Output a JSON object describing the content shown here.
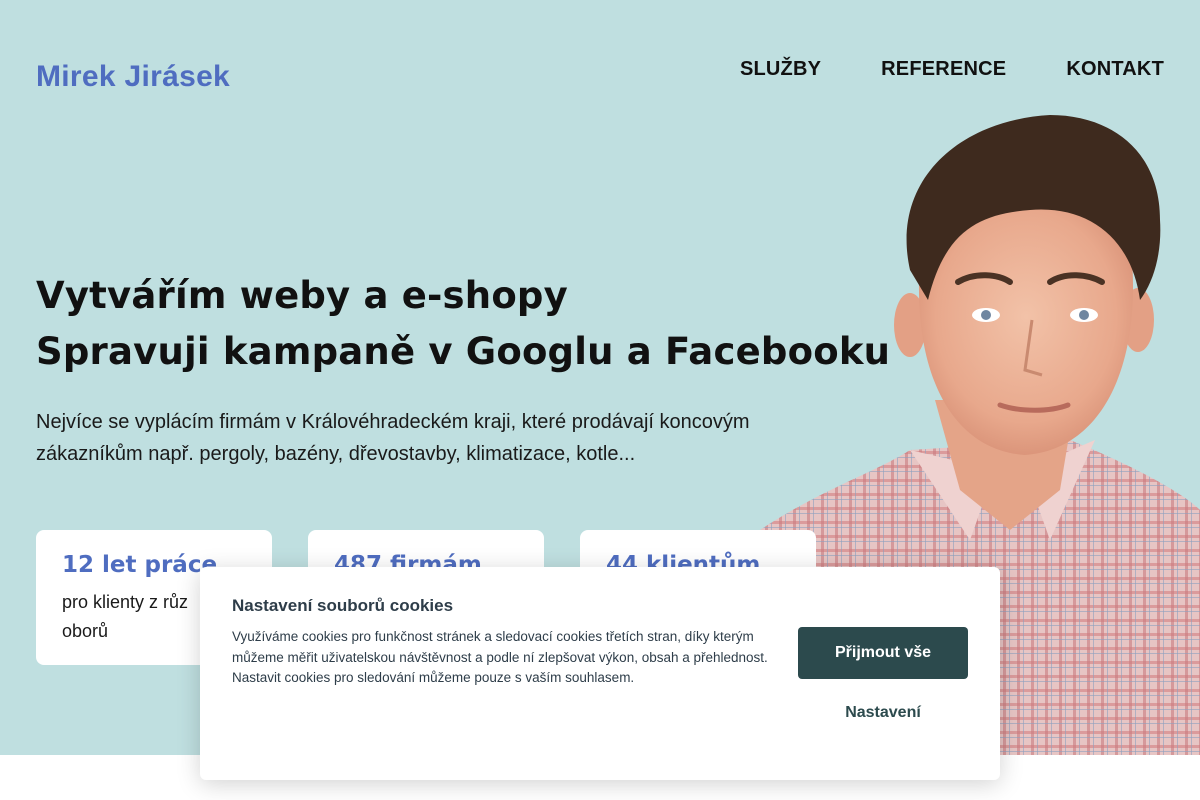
{
  "header": {
    "logo": "Mirek Jirásek",
    "nav": [
      {
        "label": "SLUŽBY"
      },
      {
        "label": "REFERENCE"
      },
      {
        "label": "KONTAKT"
      }
    ]
  },
  "hero": {
    "headline_line1": "Vytvářím weby a e-shopy",
    "headline_line2": "Spravuji kampaně v Googlu a Facebooku",
    "lead_line1": "Nejvíce se vyplácím firmám v Královéhradeckém kraji, které prodávají koncovým",
    "lead_line2": "zákazníkům např. pergoly, bazény, dřevostavby, klimatizace, kotle..."
  },
  "stats": [
    {
      "title": "12 let práce",
      "text_line1": "pro klienty z růz",
      "text_line2": "oborů"
    },
    {
      "title": "487 firmám",
      "text_line1": "",
      "text_line2": ""
    },
    {
      "title": "44 klientům",
      "text_line1": "",
      "text_line2": ""
    }
  ],
  "cookie": {
    "title": "Nastavení souborů cookies",
    "text": "Využíváme cookies pro funkčnost stránek a sledovací cookies třetích stran, díky kterým můžeme měřit uživatelskou návštěvnost a podle ní zlepšovat výkon, obsah a přehlednost. Nastavit cookies pro sledování můžeme pouze s vaším souhlasem.",
    "accept_label": "Přijmout vše",
    "settings_label": "Nastavení"
  },
  "colors": {
    "hero_bg": "#bfdfe0",
    "accent": "#4f6dc0",
    "button": "#2c4a4d"
  }
}
